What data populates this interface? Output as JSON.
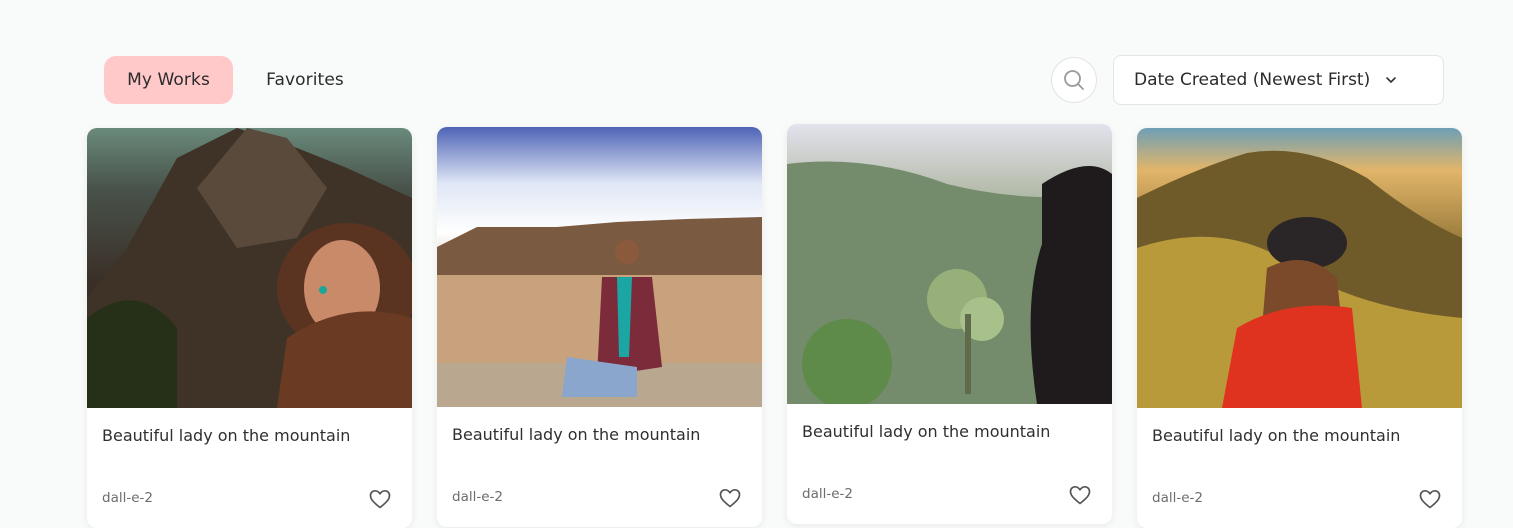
{
  "tabs": [
    {
      "label": "My Works",
      "active": true
    },
    {
      "label": "Favorites",
      "active": false
    }
  ],
  "sort": {
    "label": "Date Created (Newest First)"
  },
  "icons": {
    "search": "search-icon",
    "chevron": "chevron-down-icon",
    "heart": "heart-icon"
  },
  "colors": {
    "active_tab_bg": "#ffc9ca",
    "page_bg": "#f9fbfa"
  },
  "cards": [
    {
      "title": "Beautiful lady on the mountain",
      "model": "dall-e-2"
    },
    {
      "title": "Beautiful lady on the mountain",
      "model": "dall-e-2"
    },
    {
      "title": "Beautiful lady on the mountain",
      "model": "dall-e-2"
    },
    {
      "title": "Beautiful lady on the mountain",
      "model": "dall-e-2"
    }
  ]
}
